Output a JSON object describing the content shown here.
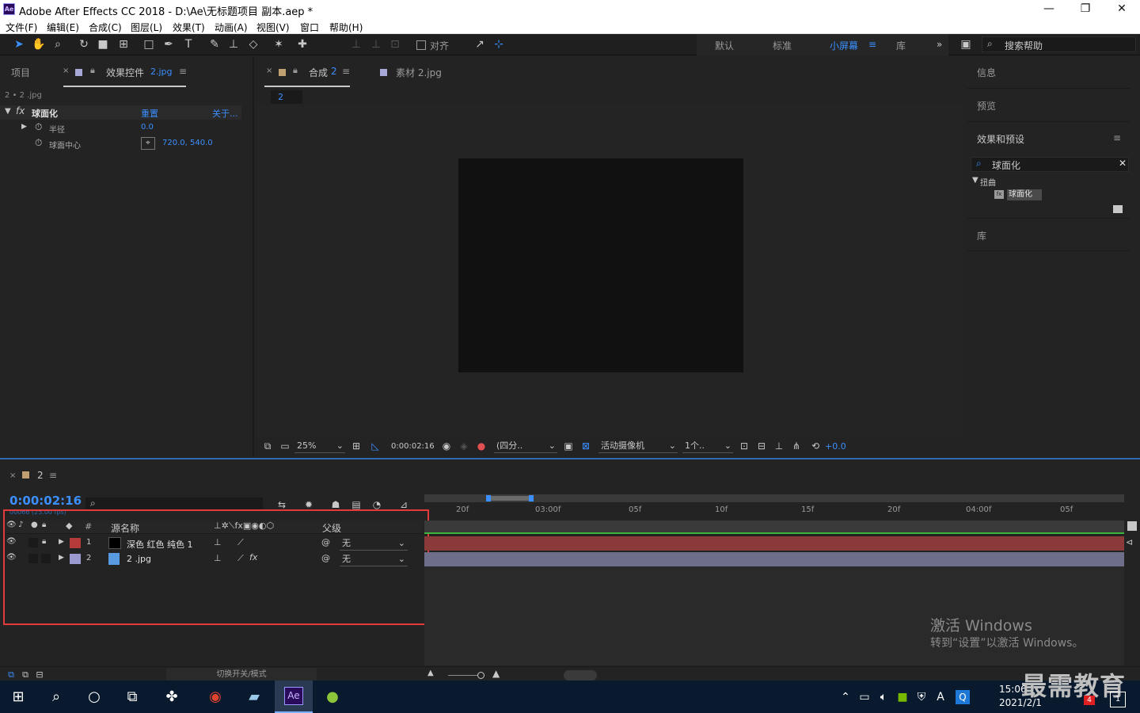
{
  "window": {
    "title": "Adobe After Effects CC 2018 - D:\\Ae\\无标题项目 副本.aep *",
    "logo": "Ae",
    "minimize": "—",
    "maximize": "❐",
    "close": "✕"
  },
  "menu": [
    "文件(F)",
    "编辑(E)",
    "合成(C)",
    "图层(L)",
    "效果(T)",
    "动画(A)",
    "视图(V)",
    "窗口",
    "帮助(H)"
  ],
  "toolbar": {
    "align_label": "对齐",
    "workspaces": [
      "默认",
      "标准",
      "小屏幕",
      "库"
    ],
    "active_workspace": "小屏幕",
    "search_placeholder": "搜索帮助"
  },
  "left_panel": {
    "tab_project": "项目",
    "tab_effects": "效果控件",
    "tab_effects_target": "2.jpg",
    "breadcrumb": "2 • 2 .jpg",
    "effect_name": "球面化",
    "reset": "重置",
    "about": "关于...",
    "params": [
      {
        "name": "半径",
        "value": "0.0"
      },
      {
        "name": "球面中心",
        "value": "720.0, 540.0"
      }
    ]
  },
  "comp_panel": {
    "tab_comp": "合成",
    "tab_comp_name": "2",
    "tab_footage": "素材 2.jpg",
    "comp_tab_badge": "2",
    "footer": {
      "zoom": "25%",
      "timecode": "0:00:02:16",
      "resolution": "(四分..",
      "camera": "活动摄像机",
      "views": "1个..",
      "exposure": "+0.0"
    }
  },
  "right_panel": {
    "info": "信息",
    "preview": "预览",
    "effects_presets": "效果和预设",
    "search_value": "球面化",
    "category": "扭曲",
    "effect_item": "球面化",
    "library": "库"
  },
  "timeline": {
    "comp_name": "2",
    "timecode": "0:00:02:16",
    "frame_info": "00066 (25.00 fps)",
    "col_source_name": "源名称",
    "col_parent": "父级",
    "col_number": "#",
    "ruler_ticks": [
      "20f",
      "03:00f",
      "05f",
      "10f",
      "15f",
      "20f",
      "04:00f",
      "05f"
    ],
    "layers": [
      {
        "num": "1",
        "name": "深色 红色 纯色 1",
        "color": "#b53a3a",
        "parent": "无",
        "bar_color": "#8b3a3a"
      },
      {
        "num": "2",
        "name": "2 .jpg",
        "color": "#9a9ad0",
        "parent": "无",
        "bar_color": "#6e6e8a"
      }
    ],
    "toggle_label": "切换开关/模式"
  },
  "watermark": {
    "line1": "激活 Windows",
    "line2": "转到“设置”以激活 Windows。",
    "brand": "最需教育"
  },
  "taskbar": {
    "time": "15:06",
    "date": "2021/2/1",
    "ime": "A",
    "notif_count": "1",
    "badge": "4"
  }
}
